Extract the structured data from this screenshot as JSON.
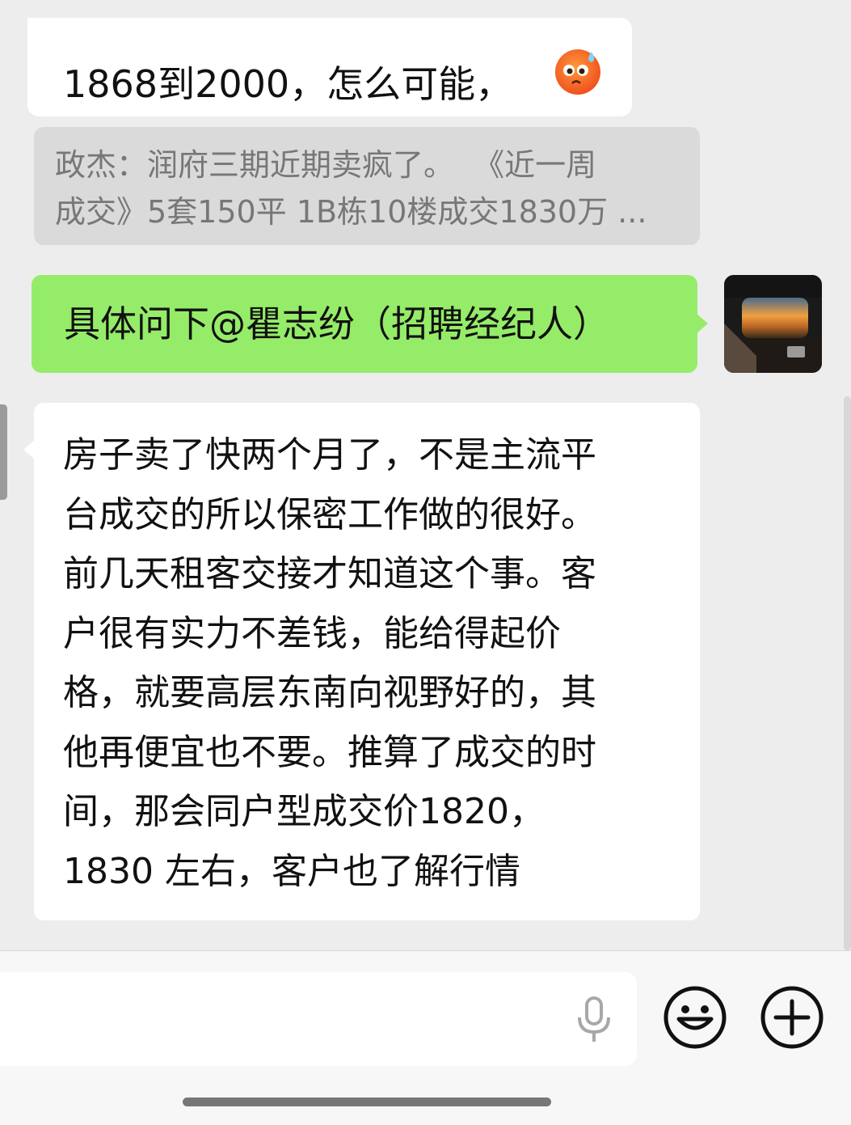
{
  "chat": {
    "messages": [
      {
        "direction": "incoming",
        "text": "1868到2000，怎么可能，",
        "emoji": "anxious-sweat-face-emoji"
      },
      {
        "type": "quote",
        "line1": "政杰：润府三期近期卖疯了。  《近一周",
        "line2": "成交》5套150平 1B栋10楼成交1830万 ..."
      },
      {
        "direction": "outgoing",
        "text": "具体问下@瞿志纷（招聘经纪人）"
      },
      {
        "direction": "incoming",
        "lines": [
          "房子卖了快两个月了，不是主流平",
          "台成交的所以保密工作做的很好。",
          "前几天租客交接才知道这个事。客",
          "户很有实力不差钱，能给得起价",
          "格，就要高层东南向视野好的，其",
          "他再便宜也不要。推算了成交的时",
          "间，那会同户型成交价1820，",
          "1830 左右，客户也了解行情"
        ]
      }
    ]
  },
  "input_bar": {
    "field_value": "",
    "icons": [
      "microphone-icon",
      "emoji-smiley-icon",
      "plus-circle-icon"
    ]
  },
  "colors": {
    "chat_bg": "#ededed",
    "incoming_bubble": "#ffffff",
    "outgoing_bubble": "#95ec69",
    "quote_bg": "#dadada",
    "quote_text": "#777777"
  }
}
